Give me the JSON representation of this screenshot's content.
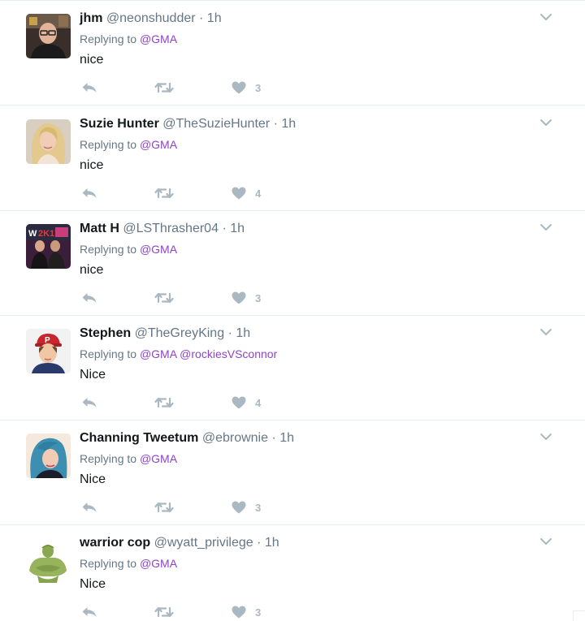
{
  "reply_prefix": "Replying to",
  "colors": {
    "accent_link": "#8e44c9",
    "muted": "#657786",
    "action_icon": "#aab8c2",
    "divider": "#e6ecf0"
  },
  "tweets": [
    {
      "name": "jhm",
      "handle": "@neonshudder",
      "separator": "·",
      "time": "1h",
      "replying_to": [
        "@GMA"
      ],
      "text": "nice",
      "likes": "3",
      "avatar": "man-glasses-dark-shirt"
    },
    {
      "name": "Suzie Hunter",
      "handle": "@TheSuzieHunter",
      "separator": "·",
      "time": "1h",
      "replying_to": [
        "@GMA"
      ],
      "text": "nice",
      "likes": "4",
      "avatar": "blonde-woman"
    },
    {
      "name": "Matt H",
      "handle": "@LSThrasher04",
      "separator": "·",
      "time": "1h",
      "replying_to": [
        "@GMA"
      ],
      "text": "nice",
      "likes": "3",
      "avatar": "wwe-2k17-photo"
    },
    {
      "name": "Stephen",
      "handle": "@TheGreyKing",
      "separator": "·",
      "time": "1h",
      "replying_to": [
        "@GMA",
        "@rockiesVSconnor"
      ],
      "text": "Nice",
      "likes": "4",
      "avatar": "cartoon-man-cap"
    },
    {
      "name": "Channing Tweetum",
      "handle": "@ebrownie",
      "separator": "·",
      "time": "1h",
      "replying_to": [
        "@GMA"
      ],
      "text": "Nice",
      "likes": "3",
      "avatar": "woman-blue-hair"
    },
    {
      "name": "warrior cop",
      "handle": "@wyatt_privilege",
      "separator": "·",
      "time": "1h",
      "replying_to": [
        "@GMA"
      ],
      "text": "Nice",
      "likes": "3",
      "avatar": "green-muscular-figure"
    }
  ]
}
